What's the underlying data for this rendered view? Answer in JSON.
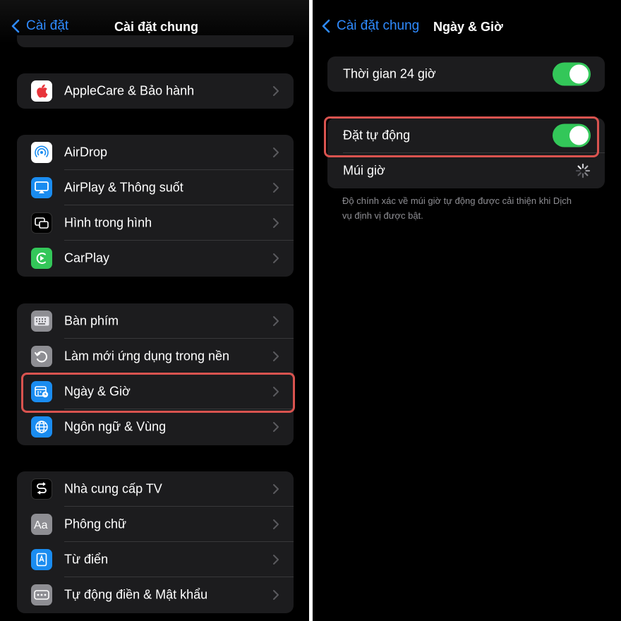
{
  "left": {
    "back_label": "Cài đặt",
    "title": "Cài đặt chung",
    "items": [
      {
        "label": "AppleCare & Bảo hành"
      },
      {
        "label": "AirDrop"
      },
      {
        "label": "AirPlay & Thông suốt"
      },
      {
        "label": "Hình trong hình"
      },
      {
        "label": "CarPlay"
      },
      {
        "label": "Bàn phím"
      },
      {
        "label": "Làm mới ứng dụng trong nền"
      },
      {
        "label": "Ngày & Giờ"
      },
      {
        "label": "Ngôn ngữ & Vùng"
      },
      {
        "label": "Nhà cung cấp TV"
      },
      {
        "label": "Phông chữ"
      },
      {
        "label": "Từ điển"
      },
      {
        "label": "Tự động điền & Mật khẩu"
      }
    ]
  },
  "right": {
    "back_label": "Cài đặt chung",
    "title": "Ngày & Giờ",
    "clock24_label": "Thời gian 24 giờ",
    "clock24_on": true,
    "auto_label": "Đặt tự động",
    "auto_on": true,
    "timezone_label": "Múi giờ",
    "footer": "Độ chính xác về múi giờ tự động được cải thiện khi Dịch vụ định vị được bật."
  },
  "colors": {
    "accent": "#2f8bff",
    "toggle_on": "#33c759",
    "highlight": "#d9534f",
    "cell_bg": "#1c1c1e"
  }
}
